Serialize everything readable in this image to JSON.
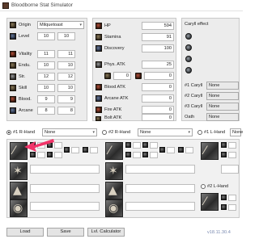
{
  "window": {
    "title": "Bloodborne Stat Simulator"
  },
  "character": {
    "origin_label": "Origin",
    "origin_value": "Milquetoast",
    "level_label": "Level",
    "level_base": "10",
    "level_current": "10",
    "stats": [
      {
        "label": "Vitality",
        "base": "11",
        "current": "11"
      },
      {
        "label": "Endu.",
        "base": "10",
        "current": "10"
      },
      {
        "label": "Str.",
        "base": "12",
        "current": "12"
      },
      {
        "label": "Skill",
        "base": "10",
        "current": "10"
      },
      {
        "label": "Blood.",
        "base": "9",
        "current": "9"
      },
      {
        "label": "Arcane",
        "base": "8",
        "current": "8"
      }
    ]
  },
  "derived": {
    "hp_label": "HP",
    "hp": "594",
    "stamina_label": "Stamina",
    "stamina": "91",
    "discovery_label": "Discovery",
    "discovery": "100",
    "phys_label": "Phys. ATK",
    "phys_a": "25",
    "phys_b": "0",
    "phys_c": "0",
    "blood_label": "Blood ATK",
    "blood": "0",
    "arcane_label": "Arcane ATK",
    "arcane": "0",
    "fire_label": "Fire ATK",
    "fire": "0",
    "bolt_label": "Bolt ATK",
    "bolt": "0"
  },
  "caryll": {
    "effect_label": "Caryll effect",
    "slots": [
      {
        "label": "#1 Caryll",
        "value": "None"
      },
      {
        "label": "#2 Caryll",
        "value": "None"
      },
      {
        "label": "#3 Caryll",
        "value": "None"
      },
      {
        "label": "Oath",
        "value": "None"
      }
    ]
  },
  "weapons": [
    {
      "label": "#1 R-Hand",
      "value": "None",
      "selected": true
    },
    {
      "label": "#2 R-Hand",
      "value": "None",
      "selected": false
    },
    {
      "label": "#1 L-Hand",
      "value": "None",
      "selected": false
    }
  ],
  "lower_right": {
    "label": "#2 L-Hand"
  },
  "footer": {
    "load": "Load",
    "save": "Save",
    "calc": "Lvl. Calculator",
    "version": "v18.11.30.4"
  },
  "colors": {
    "arrow": "#f2356a",
    "version": "#7a8ab0"
  }
}
